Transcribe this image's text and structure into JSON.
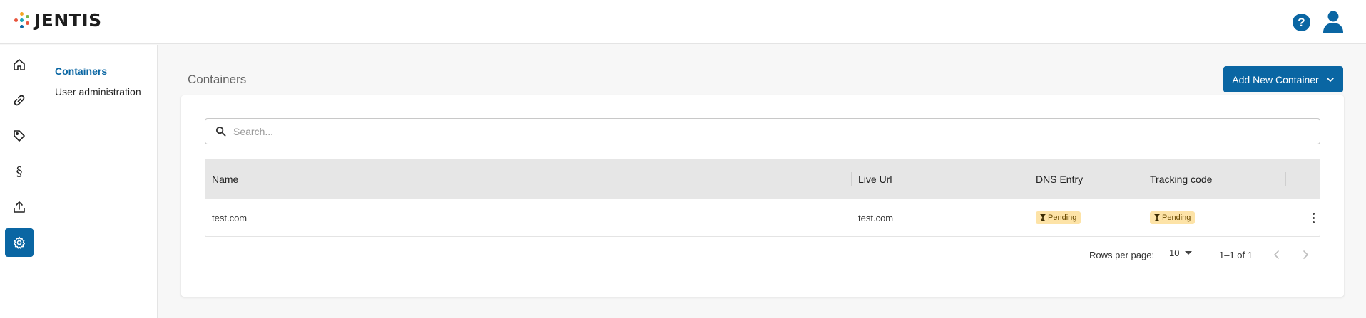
{
  "header": {
    "brand": "JENTIS",
    "help_icon": "help-circle-icon",
    "user_icon": "user-icon",
    "logo_colors": [
      "#e8553d",
      "#f6a623",
      "#1aa7b8",
      "#0a66a3",
      "#7ab648"
    ]
  },
  "sidebar": {
    "items": [
      {
        "id": "home",
        "icon": "home-icon",
        "active": false
      },
      {
        "id": "links",
        "icon": "link-icon",
        "active": false
      },
      {
        "id": "tags",
        "icon": "tag-icon",
        "active": false
      },
      {
        "id": "legal",
        "icon": "section-icon",
        "label": "§",
        "active": false
      },
      {
        "id": "publish",
        "icon": "upload-icon",
        "active": false
      },
      {
        "id": "settings",
        "icon": "gear-icon",
        "active": true
      }
    ]
  },
  "subnav": {
    "items": [
      {
        "label": "Containers",
        "active": true
      },
      {
        "label": "User administration",
        "active": false
      }
    ]
  },
  "main": {
    "title": "Containers",
    "add_button_label": "Add New Container",
    "search": {
      "placeholder": "Search...",
      "value": ""
    },
    "table": {
      "columns": [
        "Name",
        "Live Url",
        "DNS Entry",
        "Tracking code"
      ],
      "rows": [
        {
          "name": "test.com",
          "live_url": "test.com",
          "dns_entry": "Pending",
          "tracking_code": "Pending"
        }
      ]
    },
    "pagination": {
      "rows_per_page_label": "Rows per page:",
      "rows_per_page": "10",
      "range": "1–1 of 1"
    }
  },
  "colors": {
    "accent": "#0a66a3",
    "pending_badge_bg": "#fde3a7"
  }
}
